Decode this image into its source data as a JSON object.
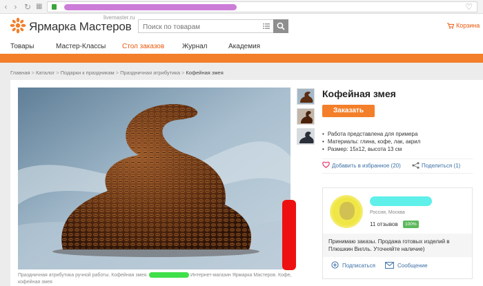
{
  "browser": {
    "icons": [
      "back-icon",
      "forward-icon",
      "reload-icon",
      "apps-icon",
      "lock-icon",
      "bookmark-heart-icon"
    ]
  },
  "header": {
    "logo_text": "Ярмарка Мастеров",
    "logo_subtext": "livemaster.ru",
    "search_placeholder": "Поиск по товарам",
    "cart_label": "Корзина"
  },
  "mainnav": {
    "items": [
      {
        "label": "Товары"
      },
      {
        "label": "Мастер-Классы"
      },
      {
        "label": "Стол заказов"
      },
      {
        "label": "Журнал"
      },
      {
        "label": "Академия"
      }
    ]
  },
  "breadcrumb": {
    "items": [
      "Главная",
      "Каталог",
      "Подарки к праздникам",
      "Праздничная атрибутика",
      "Кофейная змея"
    ]
  },
  "product": {
    "title": "Кофейная змея",
    "order_button": "Заказать",
    "properties": [
      "Работа представлена для примера",
      "Материалы: глина, кофе, лак, акрил",
      "Размер: 15х12, высота 13 см"
    ],
    "favorite_label": "Добавить в избранное (20)",
    "share_label": "Поделиться (1)",
    "caption_part1": "Праздничная атрибутика ручной работы. Кофейная змея.",
    "caption_part2": "Интернет-магазин Ярмарка Мастеров. Кофе, кофейная змея"
  },
  "seller": {
    "city": "Россия, Москва",
    "reviews": "11 отзывов",
    "rating_badge": "100%",
    "description": "Принимаю заказы. Продажа готовых изделий в Плюшкин Вилль. Уточняйте наличие)",
    "subscribe_label": "Подписаться",
    "message_label": "Сообщение"
  },
  "colors": {
    "accent": "#f47f2a",
    "link": "#3a6ea5"
  }
}
